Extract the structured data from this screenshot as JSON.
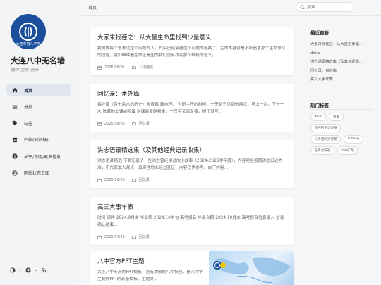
{
  "site": {
    "title": "大连八中无名墙",
    "subtitle": "愧时 雯畦 创新",
    "logo_text": "大连市第八中学"
  },
  "nav": {
    "items": [
      {
        "label": "首页",
        "icon": "home-icon"
      },
      {
        "label": "分类",
        "icon": "list-icon"
      },
      {
        "label": "标签",
        "icon": "tag-icon"
      },
      {
        "label": "归档(时间轴)",
        "icon": "archive-icon"
      },
      {
        "label": "关于/说明/更多信息",
        "icon": "info-icon"
      },
      {
        "label": "网站状态页面",
        "icon": "globe-icon"
      }
    ]
  },
  "topbar": {
    "breadcrumb": "首页",
    "search_placeholder": "搜索..."
  },
  "posts": [
    {
      "title": "大家来找茬之：从大量生命里找到少量意义",
      "excerpt": "我觉得每个思考过这个问题的人，其实已经掌握这个问题的答案了。生命本身就是不断追求那个生命意义的过程，我们继续看生命正是因为我们没有找到那个终极的意义。...",
      "date": "2026/06/01",
      "category": "八中趣稿"
    },
    {
      "title": "回忆录：番外篇",
      "excerpt": "番外篇（杂七杂八的历史）焦育鑫 教地理。 当班主任的时候，一天到只见到他两次，早上一次，下午一次 陈菲他上课咸鸭蛋 讲课喜爱能粉笔，一只手又留又接，捧了就写...",
      "date": "2025/08/06",
      "category": "回忆录"
    },
    {
      "title": "洪志语录精选集（及其他经典语录收集）",
      "excerpt": "洪志语录精选 下面记录了一些洪志曾经讲过的小故事（2024-2025学年度），内容完全按照洪志口述为准，不代表本人观点，真实性均未经过查证，内容仅供参考。由于内容...",
      "date": "2025/08/06",
      "category": "回忆录"
    },
    {
      "title": "高三大事年表",
      "excerpt": "时间 事件 2024.9月末 毕业照 2024.10中旬 高考报名 毕业合照 2024.10月末 高考报名信息录入  信息确认结束...",
      "date": "2025/07/15",
      "category": "回忆录"
    },
    {
      "title": "八中官方PPT主题",
      "excerpt": "大连八中专用的PPT模板，含有浓郁的八中特色，是八中学生制作PPT的必备模板。主题文...",
      "date": "",
      "category": ""
    }
  ],
  "right_panel": {
    "recent_title": "最近更新",
    "recent": [
      "大家来找茬之：从大量生命里...",
      "dimo",
      "洪志语录精选集（及其他经典...",
      "回忆录：番外篇",
      "高三大事年表"
    ],
    "tags_title": "热门标签",
    "tags": [
      "dimo",
      "转载",
      "曾经的生活委员",
      "口头话的步足足",
      "Yuhling",
      "方舟文学社",
      "八中广场"
    ]
  },
  "colors": {
    "accent": "#1b4f9c",
    "sidebar_bg": "#f3f4f6",
    "active_nav_bg": "#e1e6ee"
  }
}
